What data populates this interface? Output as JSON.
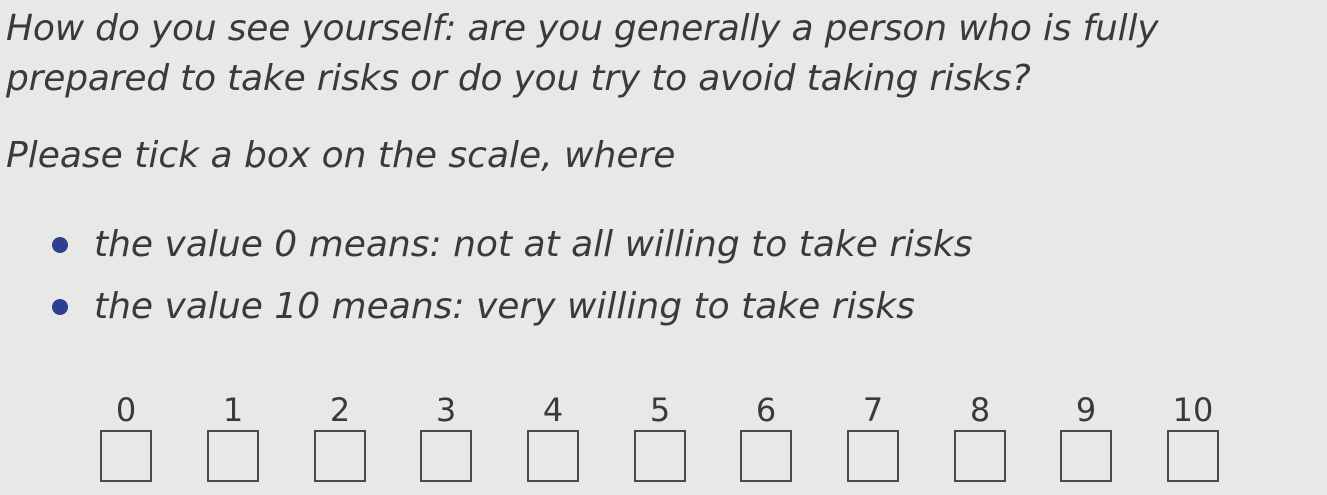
{
  "question": {
    "line1": "How do you see yourself: are you generally a person who is fully",
    "line2": "prepared to take risks or do you try to avoid taking risks?"
  },
  "instruction": "Please tick a box on the scale, where",
  "bullets": [
    {
      "text": "the value 0 means: not at all willing to take risks"
    },
    {
      "text": "the value 10 means: very willing to take risks"
    }
  ],
  "scale": {
    "options": [
      "0",
      "1",
      "2",
      "3",
      "4",
      "5",
      "6",
      "7",
      "8",
      "9",
      "10"
    ]
  },
  "colors": {
    "background": "#e8e8e7",
    "text": "#3a3a3a",
    "bullet": "#2f3f8f",
    "box_border": "#4a4a4a"
  }
}
